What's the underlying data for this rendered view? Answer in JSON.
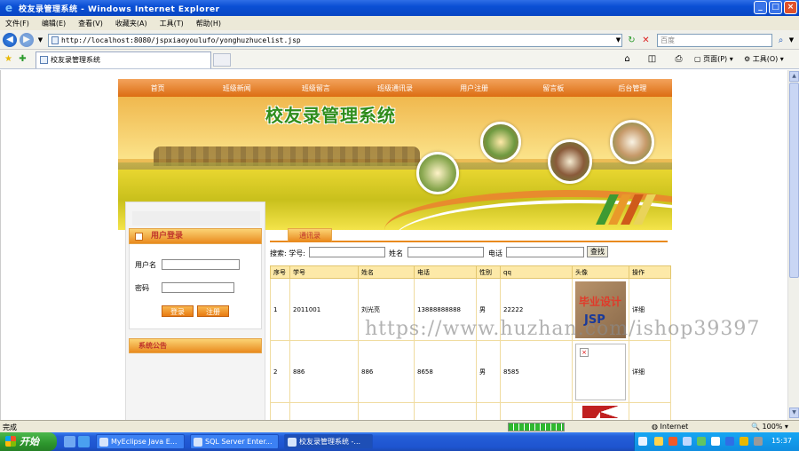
{
  "window": {
    "title": "校友录管理系统 - Windows Internet Explorer"
  },
  "menu": [
    "文件(F)",
    "编辑(E)",
    "查看(V)",
    "收藏夹(A)",
    "工具(T)",
    "帮助(H)"
  ],
  "address": {
    "url": "http://localhost:8080/jspxiaoyoulufo/yonghuzhucelist.jsp",
    "search_placeholder": "百度"
  },
  "tab": {
    "label": "校友录管理系统"
  },
  "commandbar": {
    "page": "页面(P)",
    "tools": "工具(O)"
  },
  "site": {
    "nav": [
      "首页",
      "班级新闻",
      "班级留言",
      "班级通讯录",
      "用户注册",
      "留言板",
      "后台管理"
    ],
    "banner_title": "校友录管理系统",
    "login": {
      "header": "用户登录",
      "username_label": "用户名",
      "password_label": "密码",
      "login_button": "登录",
      "register_button": "注册"
    },
    "notice_header": "系统公告",
    "list": {
      "tab": "通讯录",
      "search_prefix": "搜索: 学号:",
      "name_label": "姓名",
      "phone_label": "电话",
      "search_button": "查找",
      "columns": [
        "序号",
        "学号",
        "姓名",
        "电话",
        "性别",
        "qq",
        "头像",
        "操作"
      ],
      "rows": [
        {
          "no": "1",
          "sid": "2011001",
          "name": "刘光亮",
          "phone": "13888888888",
          "gender": "男",
          "qq": "22222",
          "action": "详细"
        },
        {
          "no": "2",
          "sid": "886",
          "name": "886",
          "phone": "8658",
          "gender": "男",
          "qq": "8585",
          "action": "详细"
        }
      ],
      "photo_text_1": "毕业设计",
      "photo_text_2": "JSP"
    }
  },
  "watermark": "https://www.huzhan.com/ishop39397",
  "status": {
    "text": "完成",
    "zone": "Internet",
    "zoom": "100%",
    "progress": 1.0
  },
  "taskbar": {
    "start": "开始",
    "tasks": [
      "MyEclipse Java E...",
      "SQL Server Enter...",
      "校友录管理系统 -..."
    ],
    "clock": "15:37"
  }
}
